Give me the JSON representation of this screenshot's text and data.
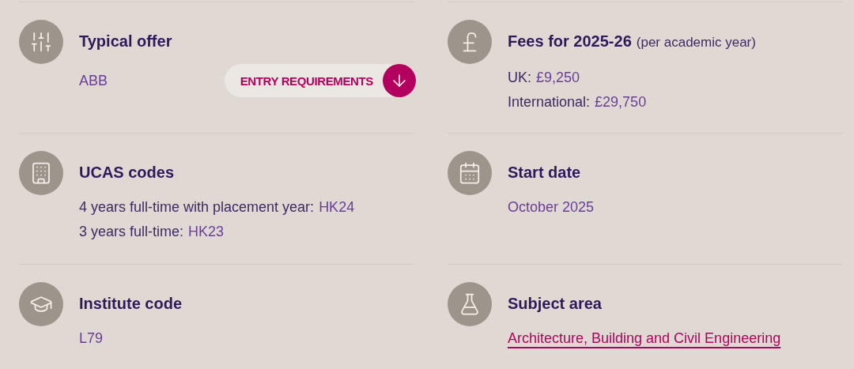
{
  "items": [
    {
      "title": "Typical offer",
      "lines": [
        {
          "kind": "value",
          "value": "ABB"
        }
      ],
      "button": {
        "label": "ENTRY REQUIREMENTS"
      }
    },
    {
      "title": "Fees for 2025-26",
      "note": "(per academic year)",
      "lines": [
        {
          "kind": "pair",
          "label": "UK:",
          "value": "£9,250"
        },
        {
          "kind": "pair",
          "label": "International:",
          "value": "£29,750"
        }
      ]
    },
    {
      "title": "UCAS codes",
      "lines": [
        {
          "kind": "pair",
          "label": "4 years full-time with placement year:",
          "value": "HK24"
        },
        {
          "kind": "pair",
          "label": "3 years full-time:",
          "value": "HK23"
        }
      ]
    },
    {
      "title": "Start date",
      "lines": [
        {
          "kind": "value",
          "value": "October 2025"
        }
      ]
    },
    {
      "title": "Institute code",
      "lines": [
        {
          "kind": "value",
          "value": "L79"
        }
      ]
    },
    {
      "title": "Subject area",
      "lines": [
        {
          "kind": "link",
          "value": "Architecture, Building and Civil Engineering"
        }
      ]
    }
  ]
}
